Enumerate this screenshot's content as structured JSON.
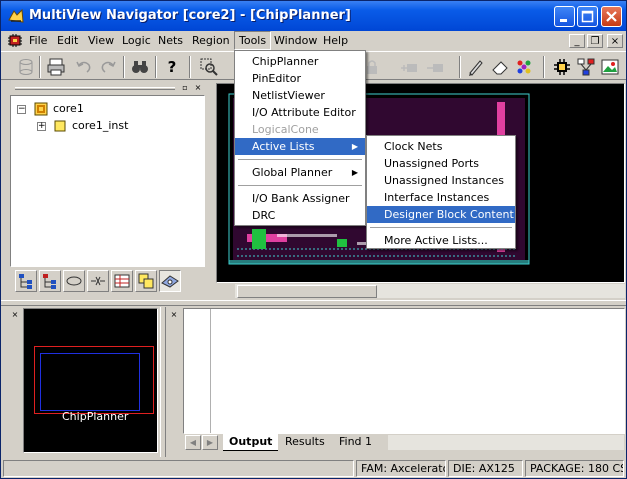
{
  "window": {
    "title": "MultiView Navigator [core2] - [ChipPlanner]",
    "title_color": "#0046d5",
    "minimize_label": "_",
    "maximize_label": "□",
    "close_label": "×"
  },
  "menubar": {
    "items": [
      "File",
      "Edit",
      "View",
      "Logic",
      "Nets",
      "Region",
      "Tools",
      "Window",
      "Help"
    ],
    "active": "Tools",
    "mdi_minimize": "_",
    "mdi_restore": "❐",
    "mdi_close": "×"
  },
  "toolbar": {
    "icons": [
      "cylinder-icon",
      "printer-icon",
      "undo-icon",
      "redo-icon",
      "binoculars-icon",
      "help-icon",
      "zoom-select-icon",
      "pencil-icon",
      "eraser-icon",
      "color-dots-icon",
      "chip-icon",
      "network-icon",
      "image-icon"
    ],
    "help_glyph": "?"
  },
  "tree": {
    "root": {
      "label": "core1",
      "toggle": "−"
    },
    "child": {
      "label": "core1_inst",
      "toggle": "+"
    },
    "header_restore": "▫",
    "header_close": "×"
  },
  "tree_tabs": [
    "hierarchy-tab-icon",
    "hierarchy-alt-tab-icon",
    "ports-tab-icon",
    "nets-tab-icon",
    "table-tab-icon",
    "layers-tab-icon",
    "eye-tab-icon"
  ],
  "tools_menu": {
    "items": [
      {
        "label": "ChipPlanner",
        "enabled": true
      },
      {
        "label": "PinEditor",
        "enabled": true
      },
      {
        "label": "NetlistViewer",
        "enabled": true
      },
      {
        "label": "I/O Attribute Editor",
        "enabled": true
      },
      {
        "label": "LogicalCone",
        "enabled": false
      },
      {
        "label": "Active Lists",
        "enabled": true,
        "submenu": true,
        "highlighted": true
      },
      {
        "label": "Global Planner",
        "enabled": true,
        "submenu": true
      },
      {
        "label": "I/O Bank Assigner",
        "enabled": true
      },
      {
        "label": "DRC",
        "enabled": true
      }
    ],
    "submenu_arrow": "▶"
  },
  "active_lists_menu": {
    "items": [
      {
        "label": "Clock Nets"
      },
      {
        "label": "Unassigned Ports"
      },
      {
        "label": "Unassigned Instances"
      },
      {
        "label": "Interface Instances"
      },
      {
        "label": "Designer Block Content",
        "highlighted": true
      },
      {
        "label": "More Active Lists..."
      }
    ]
  },
  "mini_view": {
    "label": "ChipPlanner",
    "close": "×"
  },
  "log": {
    "close": "×",
    "tabs": [
      "Output",
      "Results",
      "Find 1"
    ],
    "active_tab": "Output",
    "arrow_left": "◀",
    "arrow_right": "▶"
  },
  "statusbar": {
    "family": "FAM: Axcelerator",
    "die": "DIE: AX125",
    "package": "PACKAGE: 180 CS"
  },
  "colors": {
    "highlight": "#316ac5",
    "chip_pink": "#e040a0",
    "chip_green": "#20c040",
    "chip_cyan": "#40d0d0"
  }
}
